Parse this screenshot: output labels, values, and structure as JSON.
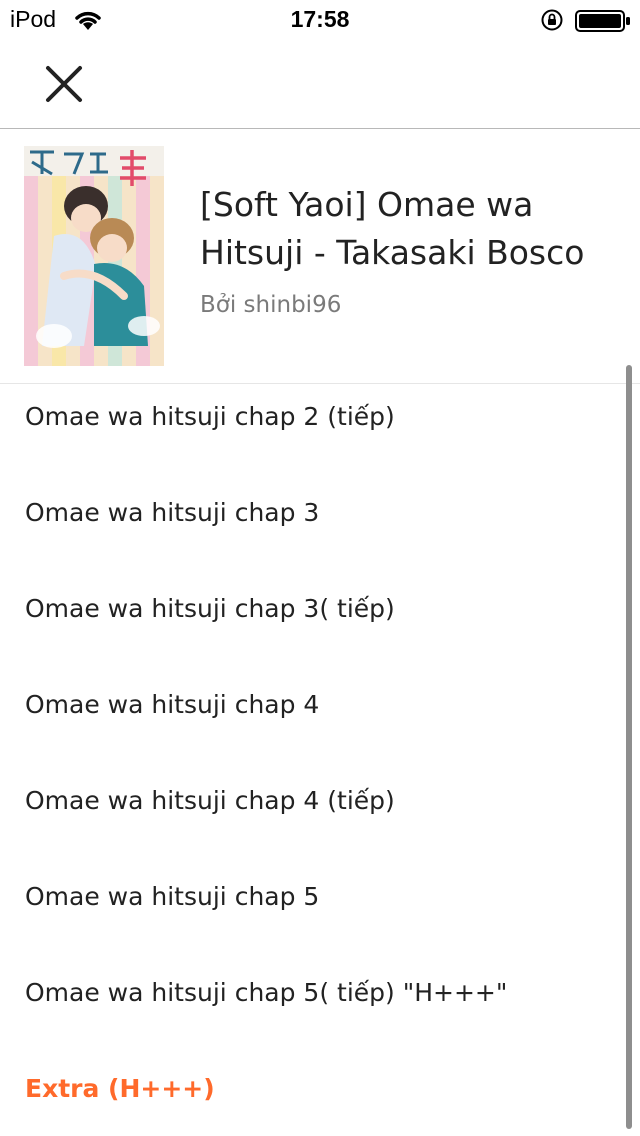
{
  "status_bar": {
    "carrier": "iPod",
    "time": "17:58",
    "icons": [
      "wifi-icon",
      "orientation-lock-icon",
      "battery-icon"
    ]
  },
  "nav": {
    "close_icon": "close-icon"
  },
  "story": {
    "title": "[Soft Yaoi] Omae wa Hitsuji - Takasaki Bosco",
    "author": "Bởi shinbi96"
  },
  "chapters": [
    "Omae wa hitsuji chap 2 (tiếp)",
    "Omae wa hitsuji chap 3",
    "Omae wa hitsuji chap 3( tiếp)",
    "Omae wa hitsuji chap 4",
    "Omae wa hitsuji chap 4 (tiếp)",
    "Omae wa hitsuji chap 5",
    "Omae wa hitsuji chap 5( tiếp) \"H+++\"",
    "Extra (H+++)"
  ],
  "colors": {
    "accent": "#ff6a2b",
    "text": "#222222",
    "muted": "#7a7a7a"
  }
}
